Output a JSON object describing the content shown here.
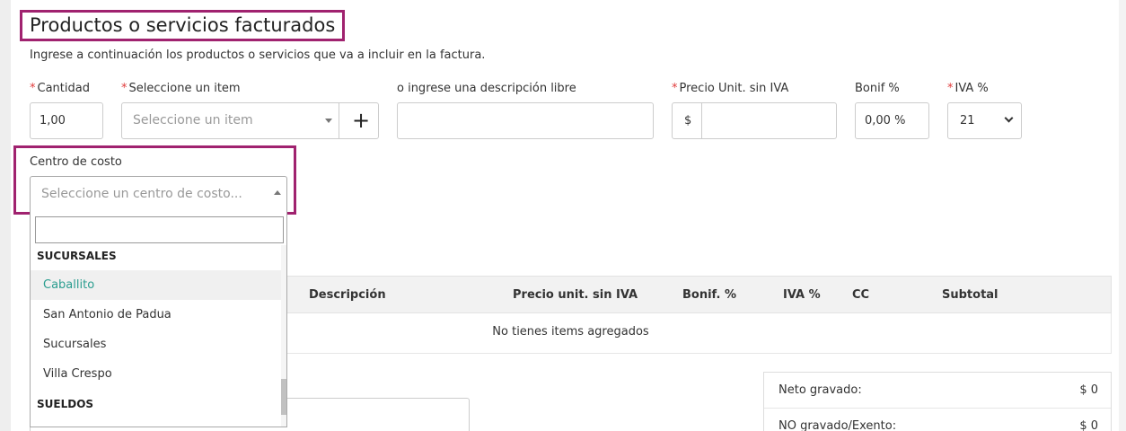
{
  "section": {
    "title": "Productos o servicios facturados",
    "subtitle": "Ingrese a continuación los productos o servicios que va a incluir en la factura."
  },
  "form": {
    "required_mark": "*",
    "cantidad": {
      "label": "Cantidad",
      "value": "1,00"
    },
    "item": {
      "label": "Seleccione un item",
      "placeholder": "Seleccione un item",
      "add_button": "+"
    },
    "descripcion": {
      "label": "o ingrese una descripción libre",
      "value": ""
    },
    "precio": {
      "label": "Precio Unit. sin IVA",
      "currency": "$",
      "value": ""
    },
    "bonif": {
      "label": "Bonif %",
      "value": "0,00 %"
    },
    "iva": {
      "label": "IVA %",
      "value": "21"
    },
    "centro_costo": {
      "label": "Centro de costo",
      "placeholder": "Seleccione un centro de costo..."
    }
  },
  "dropdown": {
    "search_value": "",
    "groups": [
      {
        "label": "SUCURSALES",
        "items": [
          "Caballito",
          "San Antonio de Padua",
          "Sucursales",
          "Villa Crespo"
        ]
      },
      {
        "label": "SUELDOS",
        "items": []
      }
    ],
    "active_item": "Caballito"
  },
  "table": {
    "columns": [
      "Descripción",
      "Precio unit. sin IVA",
      "Bonif. %",
      "IVA %",
      "CC",
      "Subtotal"
    ],
    "empty_message": "No tienes items agregados"
  },
  "totals": [
    {
      "label": "Neto gravado:",
      "value": "$ 0"
    },
    {
      "label": "NO gravado/Exento:",
      "value": "$ 0"
    }
  ],
  "colors": {
    "highlight": "#a0226f",
    "required": "#e03a3a",
    "active_option": "#2a9d8f"
  },
  "icons": {
    "select_caret": "caret-down-icon",
    "open_caret": "caret-up-icon",
    "iva_chevron": "chevron-down-icon",
    "add": "plus-icon"
  }
}
